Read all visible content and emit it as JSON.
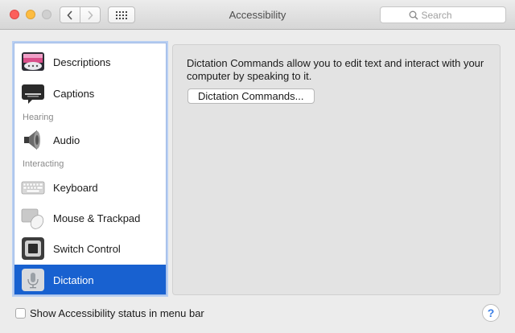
{
  "window": {
    "title": "Accessibility"
  },
  "toolbar": {
    "search_placeholder": "Search"
  },
  "sidebar": {
    "items": [
      {
        "label": "Descriptions",
        "icon": "descriptions-icon"
      },
      {
        "label": "Captions",
        "icon": "captions-icon"
      },
      {
        "label": "Audio",
        "icon": "speaker-icon"
      },
      {
        "label": "Keyboard",
        "icon": "keyboard-icon"
      },
      {
        "label": "Mouse & Trackpad",
        "icon": "mouse-trackpad-icon"
      },
      {
        "label": "Switch Control",
        "icon": "switch-control-icon"
      },
      {
        "label": "Dictation",
        "icon": "microphone-icon",
        "selected": true
      }
    ],
    "sections": {
      "hearing": "Hearing",
      "interacting": "Interacting"
    }
  },
  "content": {
    "description": "Dictation Commands allow you to edit text and interact with your computer by speaking to it.",
    "button_label": "Dictation Commands..."
  },
  "footer": {
    "checkbox_label": "Show Accessibility status in menu bar",
    "checkbox_checked": false,
    "help_label": "?"
  },
  "colors": {
    "selection": "#1861d0",
    "close": "#fc605c",
    "minimize": "#fdbc40",
    "zoom": "#d0d0d0"
  }
}
